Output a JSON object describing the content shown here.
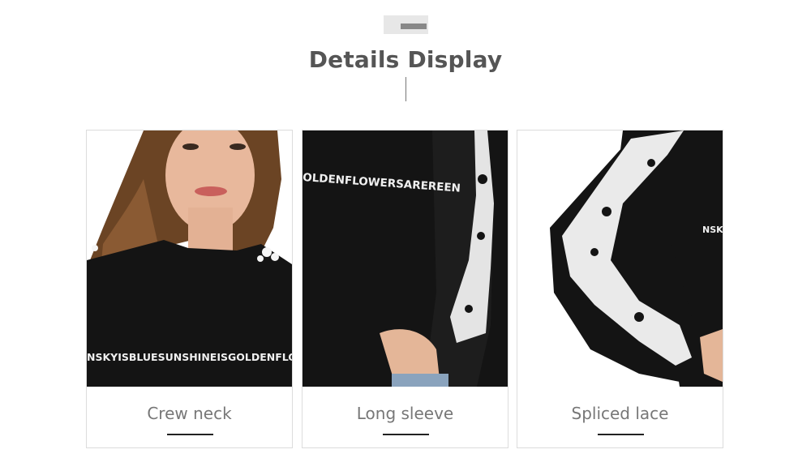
{
  "section": {
    "title": "Details Display"
  },
  "details": [
    {
      "caption": "Crew neck",
      "print_text": "NSKYISBLUESUNSHINEISGOLDENFLOWERSI"
    },
    {
      "caption": "Long sleeve",
      "print_text": "OLDENFLOWERSAREREEN"
    },
    {
      "caption": "Spliced lace",
      "print_text": "NSK"
    }
  ],
  "colors": {
    "title": "#555555",
    "caption": "#777777",
    "underline": "#222222",
    "card_border": "#dcdcdc",
    "garment": "#141414",
    "lace": "#f5f5f5"
  }
}
